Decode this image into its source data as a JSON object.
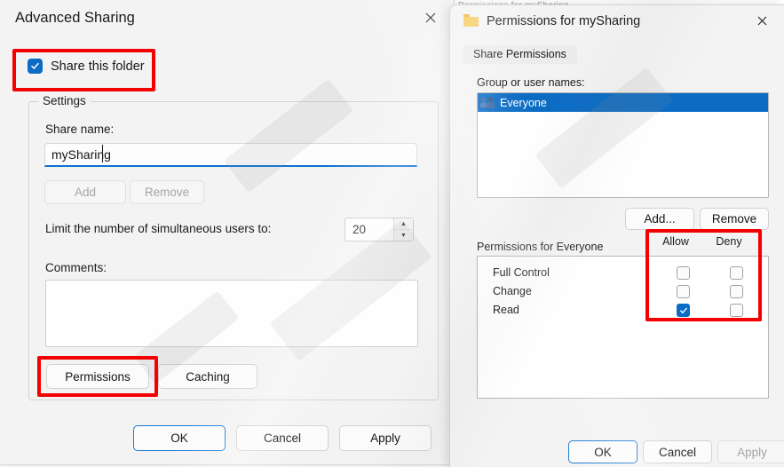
{
  "left_dialog": {
    "title": "Advanced Sharing",
    "close_icon": "close-icon",
    "share_folder_checkbox": {
      "label": "Share this folder",
      "checked": true
    },
    "settings_group": {
      "legend": "Settings",
      "share_name_label": "Share name:",
      "share_name_value": "mySharing",
      "share_name_placeholder": "",
      "add_button": "Add",
      "remove_button": "Remove",
      "add_enabled": false,
      "remove_enabled": false,
      "limit_label": "Limit the number of simultaneous users to:",
      "limit_value": "20",
      "spinner_up": "▲",
      "spinner_down": "▼",
      "comments_label": "Comments:",
      "comments_value": "",
      "permissions_button": "Permissions",
      "caching_button": "Caching"
    },
    "footer": {
      "ok": "OK",
      "cancel": "Cancel",
      "apply": "Apply"
    }
  },
  "background_window": {
    "partial_title": "Permissions for mySharing"
  },
  "right_dialog": {
    "title": "Permissions for mySharing",
    "folder_icon": "folder-icon",
    "close_icon": "close-icon",
    "tabs": [
      {
        "label": "Share Permissions",
        "active": true
      }
    ],
    "group_names_label": "Group or user names:",
    "group_list": [
      {
        "name": "Everyone",
        "selected": true,
        "icon": "users-icon"
      }
    ],
    "add_button": "Add...",
    "remove_button": "Remove",
    "permissions_for_label": "Permissions for Everyone",
    "columns": [
      "Allow",
      "Deny"
    ],
    "permissions": [
      {
        "name": "Full Control",
        "allow": false,
        "deny": false
      },
      {
        "name": "Change",
        "allow": false,
        "deny": false
      },
      {
        "name": "Read",
        "allow": true,
        "deny": false
      }
    ],
    "footer": {
      "ok": "OK",
      "cancel": "Cancel",
      "apply": "Apply",
      "apply_enabled": false
    }
  },
  "annotations": {
    "accent_color": "#f50000",
    "highlight_targets": [
      "share-this-folder",
      "permissions-button",
      "allow-deny-column"
    ]
  },
  "theme": {
    "accent": "#0b6cc4",
    "dialog_bg": "#f3f3f3",
    "field_bg": "#ffffff",
    "focus_border": "#1a7ad4"
  }
}
